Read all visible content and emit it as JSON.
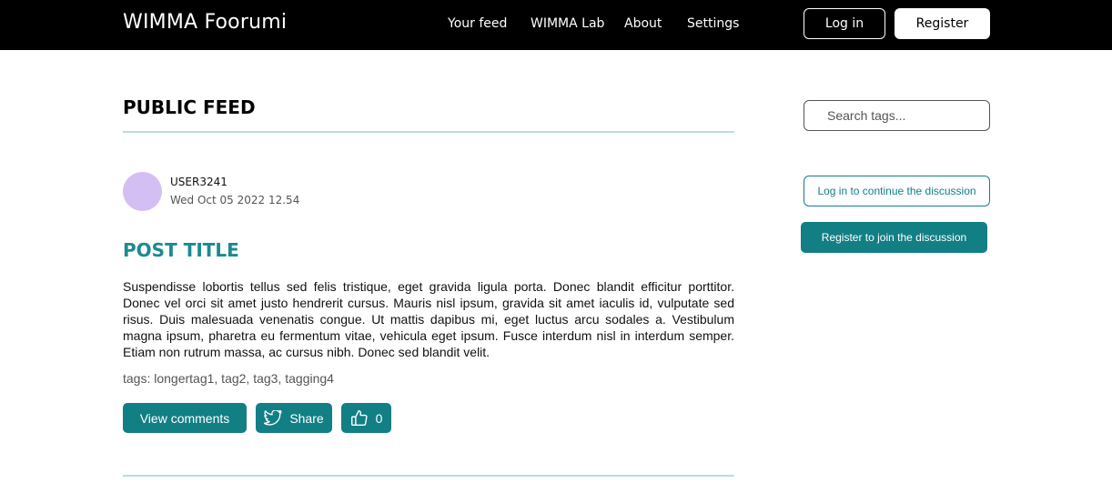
{
  "header": {
    "brand": "WIMMA Foorumi",
    "nav": [
      {
        "label": "Your feed"
      },
      {
        "label": "WIMMA Lab"
      },
      {
        "label": "About"
      },
      {
        "label": "Settings"
      }
    ],
    "login_label": "Log in",
    "register_label": "Register"
  },
  "feed": {
    "title": "PUBLIC FEED",
    "post": {
      "username": "USER3241",
      "timestamp": "Wed Oct 05 2022 12.54",
      "title": "POST TITLE",
      "body": "Suspendisse lobortis tellus sed felis tristique, eget gravida ligula porta. Donec blandit efficitur porttitor. Donec vel orci sit amet justo hendrerit cursus. Mauris nisl ipsum, gravida sit amet iaculis id, vulputate sed risus. Duis malesuada venenatis congue. Ut mattis dapibus mi, eget luctus arcu sodales a. Vestibulum magna ipsum, pharetra eu fermentum vitae, vehicula eget ipsum. Fusce interdum nisl in interdum semper. Etiam non rutrum massa, ac cursus nibh. Donec sed blandit velit.",
      "tags": "tags: longertag1, tag2, tag3, tagging4",
      "view_comments_label": "View comments",
      "share_label": "Share",
      "like_count": "0",
      "share_icon": "twitter-bird-icon",
      "like_icon": "thumbs-up-icon"
    }
  },
  "sidebar": {
    "search_placeholder": "Search tags...",
    "login_cta": "Log in to continue the discussion",
    "register_cta": "Register to join the discussion"
  },
  "colors": {
    "accent": "#127f85",
    "post_title": "#1b8a91",
    "divider": "#b7dde0",
    "avatar": "#d4bff2",
    "header_bg": "#000000"
  }
}
